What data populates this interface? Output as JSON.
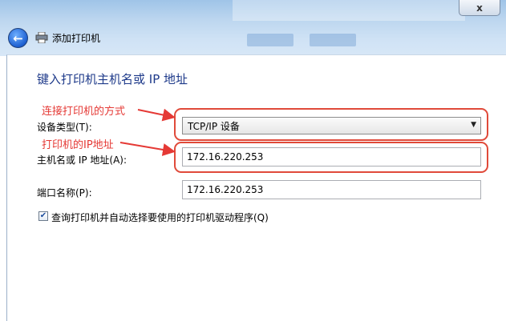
{
  "window": {
    "title": "添加打印机",
    "close_symbol": "x",
    "back_icon": "back-arrow-icon",
    "printer_icon": "printer-icon"
  },
  "page": {
    "heading": "键入打印机主机名或 IP 地址"
  },
  "annotations": {
    "connection_method": "连接打印机的方式",
    "ip_address": "打印机的IP地址",
    "color": "#e53935"
  },
  "form": {
    "device_type_label": "设备类型(T):",
    "device_type_value": "TCP/IP 设备",
    "hostname_label": "主机名或 IP 地址(A):",
    "hostname_value": "172.16.220.253",
    "port_label": "端口名称(P):",
    "port_value": "172.16.220.253",
    "query_checkbox_label": "查询打印机并自动选择要使用的打印机驱动程序(Q)",
    "query_checked": true
  }
}
